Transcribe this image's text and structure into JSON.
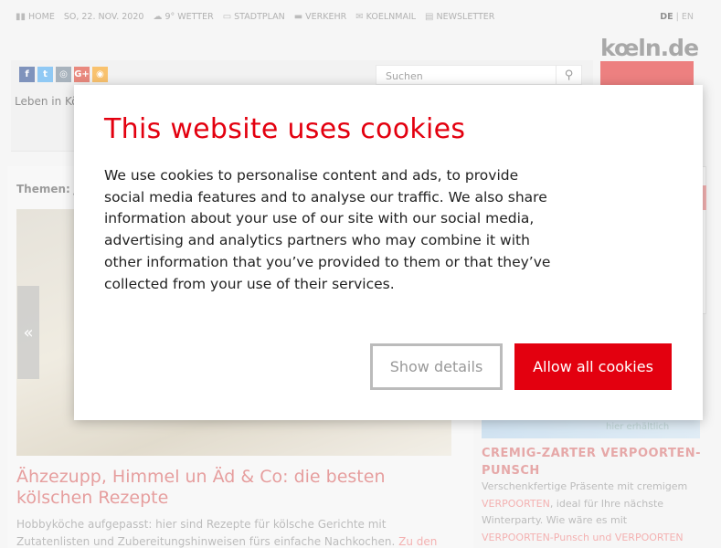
{
  "topnav": {
    "home": "HOME",
    "date": "SO, 22. NOV. 2020",
    "weather": "9° WETTER",
    "stadtplan": "STADTPLAN",
    "verkehr": "VERKEHR",
    "koelnmail": "KOELNMAIL",
    "newsletter": "NEWSLETTER"
  },
  "lang": {
    "de": "DE",
    "sep": " | ",
    "en": "EN"
  },
  "logo": {
    "text": "kœln.de"
  },
  "socials": [
    {
      "icon": "facebook-icon",
      "glyph": "f",
      "color": "#3b5998"
    },
    {
      "icon": "twitter-icon",
      "glyph": "t",
      "color": "#55acee"
    },
    {
      "icon": "instagram-icon",
      "glyph": "◎",
      "color": "#7a8a9a"
    },
    {
      "icon": "googleplus-icon",
      "glyph": "G+",
      "color": "#dd4b39"
    },
    {
      "icon": "rss-icon",
      "glyph": "◉",
      "color": "#f6a121"
    }
  ],
  "search": {
    "placeholder": "Suchen"
  },
  "tagline": "Leben in Kö",
  "themen_label": "Themen: J",
  "slider": {
    "prev": "«"
  },
  "article": {
    "title": "Ähzezupp, Himmel un Äd & Co: die besten kölschen Rezepte",
    "text": "Hobbyköche aufgepasst: hier sind Rezepte für kölsche Gerichte mit Zutatenlisten und Zubereitungshinweisen fürs einfache Nachkochen.",
    "link": "Zu den Rezepten"
  },
  "ad": {
    "image_link": "hier erhältlich",
    "title": "CREMIG-ZARTER VERPOORTEN-PUNSCH",
    "text_1": "Verschenkfertige Präsente mit cremigem",
    "text_hl1": "VERPOORTEN",
    "text_2": ", ideal für Ihre nächste Winterparty. Wie wäre es mit",
    "text_hl2": "VERPOORTEN-Punsch und VERPOORTEN"
  },
  "cookie_dialog": {
    "title": "This website uses cookies",
    "body": "We use cookies to personalise content and ads, to provide social media features and to analyse our traffic. We also share information about your use of our site with our social media, advertising and analytics partners who may combine it with other information that you’ve provided to them or that they’ve collected from your use of their services.",
    "details_label": "Show details",
    "allow_label": "Allow all cookies"
  },
  "colors": {
    "accent": "#e3000f",
    "logo_bar": "#e33d3d"
  }
}
